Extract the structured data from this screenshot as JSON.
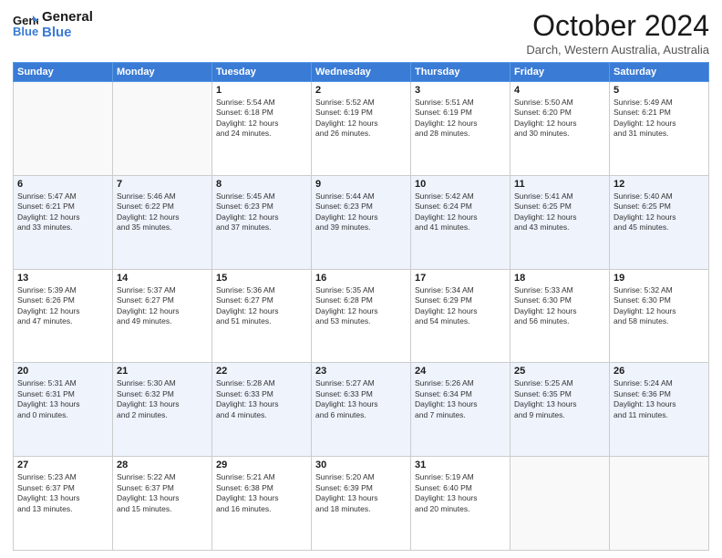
{
  "logo": {
    "line1": "General",
    "line2": "Blue"
  },
  "title": "October 2024",
  "subtitle": "Darch, Western Australia, Australia",
  "days_of_week": [
    "Sunday",
    "Monday",
    "Tuesday",
    "Wednesday",
    "Thursday",
    "Friday",
    "Saturday"
  ],
  "weeks": [
    [
      {
        "day": "",
        "info": ""
      },
      {
        "day": "",
        "info": ""
      },
      {
        "day": "1",
        "info": "Sunrise: 5:54 AM\nSunset: 6:18 PM\nDaylight: 12 hours\nand 24 minutes."
      },
      {
        "day": "2",
        "info": "Sunrise: 5:52 AM\nSunset: 6:19 PM\nDaylight: 12 hours\nand 26 minutes."
      },
      {
        "day": "3",
        "info": "Sunrise: 5:51 AM\nSunset: 6:19 PM\nDaylight: 12 hours\nand 28 minutes."
      },
      {
        "day": "4",
        "info": "Sunrise: 5:50 AM\nSunset: 6:20 PM\nDaylight: 12 hours\nand 30 minutes."
      },
      {
        "day": "5",
        "info": "Sunrise: 5:49 AM\nSunset: 6:21 PM\nDaylight: 12 hours\nand 31 minutes."
      }
    ],
    [
      {
        "day": "6",
        "info": "Sunrise: 5:47 AM\nSunset: 6:21 PM\nDaylight: 12 hours\nand 33 minutes."
      },
      {
        "day": "7",
        "info": "Sunrise: 5:46 AM\nSunset: 6:22 PM\nDaylight: 12 hours\nand 35 minutes."
      },
      {
        "day": "8",
        "info": "Sunrise: 5:45 AM\nSunset: 6:23 PM\nDaylight: 12 hours\nand 37 minutes."
      },
      {
        "day": "9",
        "info": "Sunrise: 5:44 AM\nSunset: 6:23 PM\nDaylight: 12 hours\nand 39 minutes."
      },
      {
        "day": "10",
        "info": "Sunrise: 5:42 AM\nSunset: 6:24 PM\nDaylight: 12 hours\nand 41 minutes."
      },
      {
        "day": "11",
        "info": "Sunrise: 5:41 AM\nSunset: 6:25 PM\nDaylight: 12 hours\nand 43 minutes."
      },
      {
        "day": "12",
        "info": "Sunrise: 5:40 AM\nSunset: 6:25 PM\nDaylight: 12 hours\nand 45 minutes."
      }
    ],
    [
      {
        "day": "13",
        "info": "Sunrise: 5:39 AM\nSunset: 6:26 PM\nDaylight: 12 hours\nand 47 minutes."
      },
      {
        "day": "14",
        "info": "Sunrise: 5:37 AM\nSunset: 6:27 PM\nDaylight: 12 hours\nand 49 minutes."
      },
      {
        "day": "15",
        "info": "Sunrise: 5:36 AM\nSunset: 6:27 PM\nDaylight: 12 hours\nand 51 minutes."
      },
      {
        "day": "16",
        "info": "Sunrise: 5:35 AM\nSunset: 6:28 PM\nDaylight: 12 hours\nand 53 minutes."
      },
      {
        "day": "17",
        "info": "Sunrise: 5:34 AM\nSunset: 6:29 PM\nDaylight: 12 hours\nand 54 minutes."
      },
      {
        "day": "18",
        "info": "Sunrise: 5:33 AM\nSunset: 6:30 PM\nDaylight: 12 hours\nand 56 minutes."
      },
      {
        "day": "19",
        "info": "Sunrise: 5:32 AM\nSunset: 6:30 PM\nDaylight: 12 hours\nand 58 minutes."
      }
    ],
    [
      {
        "day": "20",
        "info": "Sunrise: 5:31 AM\nSunset: 6:31 PM\nDaylight: 13 hours\nand 0 minutes."
      },
      {
        "day": "21",
        "info": "Sunrise: 5:30 AM\nSunset: 6:32 PM\nDaylight: 13 hours\nand 2 minutes."
      },
      {
        "day": "22",
        "info": "Sunrise: 5:28 AM\nSunset: 6:33 PM\nDaylight: 13 hours\nand 4 minutes."
      },
      {
        "day": "23",
        "info": "Sunrise: 5:27 AM\nSunset: 6:33 PM\nDaylight: 13 hours\nand 6 minutes."
      },
      {
        "day": "24",
        "info": "Sunrise: 5:26 AM\nSunset: 6:34 PM\nDaylight: 13 hours\nand 7 minutes."
      },
      {
        "day": "25",
        "info": "Sunrise: 5:25 AM\nSunset: 6:35 PM\nDaylight: 13 hours\nand 9 minutes."
      },
      {
        "day": "26",
        "info": "Sunrise: 5:24 AM\nSunset: 6:36 PM\nDaylight: 13 hours\nand 11 minutes."
      }
    ],
    [
      {
        "day": "27",
        "info": "Sunrise: 5:23 AM\nSunset: 6:37 PM\nDaylight: 13 hours\nand 13 minutes."
      },
      {
        "day": "28",
        "info": "Sunrise: 5:22 AM\nSunset: 6:37 PM\nDaylight: 13 hours\nand 15 minutes."
      },
      {
        "day": "29",
        "info": "Sunrise: 5:21 AM\nSunset: 6:38 PM\nDaylight: 13 hours\nand 16 minutes."
      },
      {
        "day": "30",
        "info": "Sunrise: 5:20 AM\nSunset: 6:39 PM\nDaylight: 13 hours\nand 18 minutes."
      },
      {
        "day": "31",
        "info": "Sunrise: 5:19 AM\nSunset: 6:40 PM\nDaylight: 13 hours\nand 20 minutes."
      },
      {
        "day": "",
        "info": ""
      },
      {
        "day": "",
        "info": ""
      }
    ]
  ]
}
